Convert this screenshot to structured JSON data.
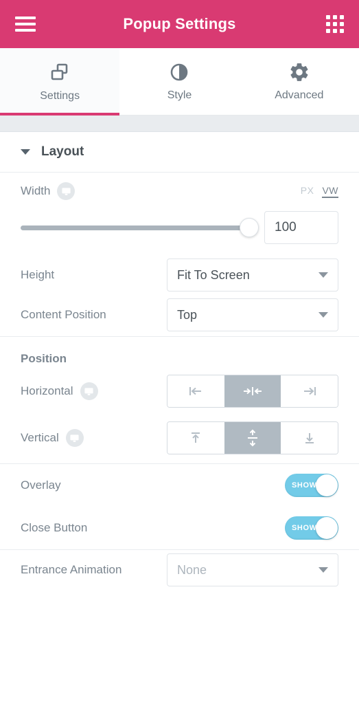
{
  "header": {
    "title": "Popup Settings",
    "menu_icon": "hamburger-menu-icon",
    "apps_icon": "apps-grid-icon",
    "background_color": "#d93a72"
  },
  "tabs": [
    {
      "label": "Settings",
      "icon": "layers-icon",
      "active": true
    },
    {
      "label": "Style",
      "icon": "contrast-icon",
      "active": false
    },
    {
      "label": "Advanced",
      "icon": "gear-icon",
      "active": false
    }
  ],
  "sections": {
    "layout": {
      "title": "Layout",
      "expanded": true,
      "caret_icon": "chevron-down-icon"
    }
  },
  "controls": {
    "width": {
      "label": "Width",
      "device_icon": "desktop-monitor-icon",
      "units": [
        {
          "label": "PX",
          "active": false
        },
        {
          "label": "VW",
          "active": true
        }
      ],
      "value": "100",
      "slider_percent": 100
    },
    "height": {
      "label": "Height",
      "value": "Fit To Screen",
      "caret_icon": "chevron-down-icon"
    },
    "content_position": {
      "label": "Content Position",
      "value": "Top",
      "caret_icon": "chevron-down-icon"
    },
    "position_subsection": {
      "title": "Position"
    },
    "horizontal": {
      "label": "Horizontal",
      "device_icon": "desktop-monitor-icon",
      "options": [
        {
          "name": "align-left-icon",
          "selected": false
        },
        {
          "name": "align-center-horizontal-icon",
          "selected": true
        },
        {
          "name": "align-right-icon",
          "selected": false
        }
      ]
    },
    "vertical": {
      "label": "Vertical",
      "device_icon": "desktop-monitor-icon",
      "options": [
        {
          "name": "align-top-icon",
          "selected": false
        },
        {
          "name": "align-center-vertical-icon",
          "selected": true
        },
        {
          "name": "align-bottom-icon",
          "selected": false
        }
      ]
    },
    "overlay": {
      "label": "Overlay",
      "toggle_label": "SHOW",
      "on": true
    },
    "close_button": {
      "label": "Close Button",
      "toggle_label": "SHOW",
      "on": true
    },
    "entrance_animation": {
      "label": "Entrance Animation",
      "value": "None",
      "caret_icon": "chevron-down-icon"
    }
  },
  "colors": {
    "accent_pink": "#d93a72",
    "toggle_on": "#72cbe8",
    "selected_choice": "#b0bac2"
  }
}
